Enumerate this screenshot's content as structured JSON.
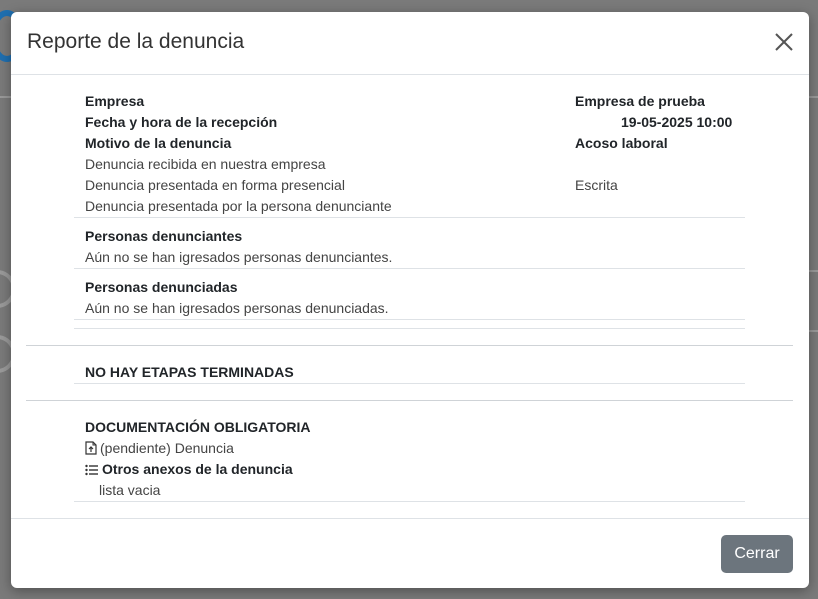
{
  "modal": {
    "title": "Reporte de la denuncia",
    "close_label": "Cerrar"
  },
  "details": {
    "empresa_label": "Empresa",
    "empresa_value": "Empresa de prueba",
    "fecha_label": "Fecha y hora de la recepción",
    "fecha_value": "19-05-2025 10:00",
    "motivo_label": "Motivo de la denuncia",
    "motivo_value": "Acoso laboral",
    "recibida": "Denuncia recibida en nuestra empresa",
    "presentada_forma": "Denuncia presentada en forma presencial",
    "presentada_forma_value": "Escrita",
    "presentada_por": "Denuncia presentada por la persona denunciante"
  },
  "denunciantes": {
    "title": "Personas denunciantes",
    "empty": "Aún no se han igresados personas denunciantes."
  },
  "denunciadas": {
    "title": "Personas denunciadas",
    "empty": "Aún no se han igresados personas denunciadas."
  },
  "etapas": {
    "title": "NO HAY ETAPAS TERMINADAS"
  },
  "documentacion": {
    "title": "DOCUMENTACIÓN OBLIGATORIA",
    "doc_item": "(pendiente) Denuncia",
    "doc_icon": "file-upload-icon",
    "anexos_title": "Otros anexos de la denuncia",
    "anexos_icon": "list-icon",
    "anexos_empty": "lista vacia"
  },
  "colors": {
    "footer_button": "#6c757d",
    "backdrop": "#7a7a7a"
  }
}
